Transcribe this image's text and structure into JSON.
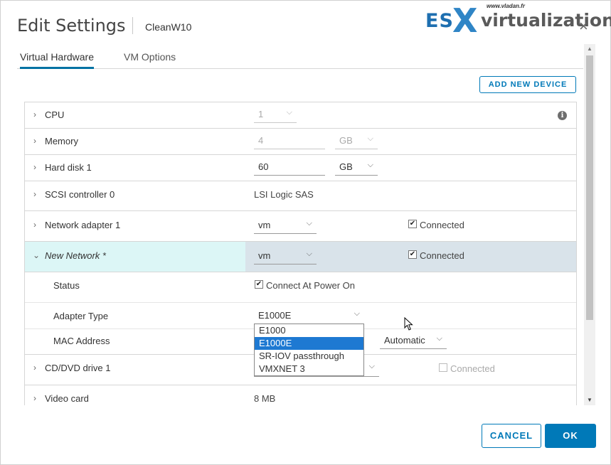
{
  "dialog": {
    "title": "Edit Settings",
    "vm_name": "CleanW10",
    "close_glyph": "×"
  },
  "watermark": {
    "brand_prefix": "ES",
    "brand_x": "X",
    "brand_suffix": "virtualization",
    "url": "www.vladan.fr"
  },
  "tabs": [
    {
      "label": "Virtual Hardware",
      "active": true
    },
    {
      "label": "VM Options",
      "active": false
    }
  ],
  "add_device_label": "ADD NEW DEVICE",
  "hardware": {
    "cpu": {
      "label": "CPU",
      "value": "1"
    },
    "memory": {
      "label": "Memory",
      "value": "4",
      "unit": "GB"
    },
    "hard_disk": {
      "label": "Hard disk 1",
      "value": "60",
      "unit": "GB"
    },
    "scsi": {
      "label": "SCSI controller 0",
      "value": "LSI Logic SAS"
    },
    "network1": {
      "label": "Network adapter 1",
      "network": "vm",
      "connected_label": "Connected",
      "connected": true
    },
    "new_network": {
      "label": "New Network *",
      "network": "vm",
      "connected_label": "Connected",
      "connected": true,
      "status_label": "Status",
      "power_on_label": "Connect At Power On",
      "power_on": true,
      "adapter_type_label": "Adapter Type",
      "adapter_type_value": "E1000E",
      "adapter_options": [
        "E1000",
        "E1000E",
        "SR-IOV passthrough",
        "VMXNET 3"
      ],
      "selected_option_index": 1,
      "mac_label": "MAC Address",
      "mac_mode": "Automatic"
    },
    "cdrom": {
      "label": "CD/DVD drive 1",
      "connected_label": "Connected",
      "connected": false
    },
    "video": {
      "label": "Video card",
      "value": "8 MB"
    }
  },
  "footer": {
    "cancel_label": "CANCEL",
    "ok_label": "OK"
  },
  "colors": {
    "accent": "#0079b8",
    "selected_option": "#1e79d2",
    "expanded_row_left": "#dcf6f6",
    "expanded_row_right": "#d9e3ea"
  },
  "icons": {
    "close": "close-icon",
    "expand": "chevron-right-icon",
    "collapse": "chevron-down-icon",
    "info": "info-icon",
    "dropdown_caret": "caret-down-icon"
  }
}
